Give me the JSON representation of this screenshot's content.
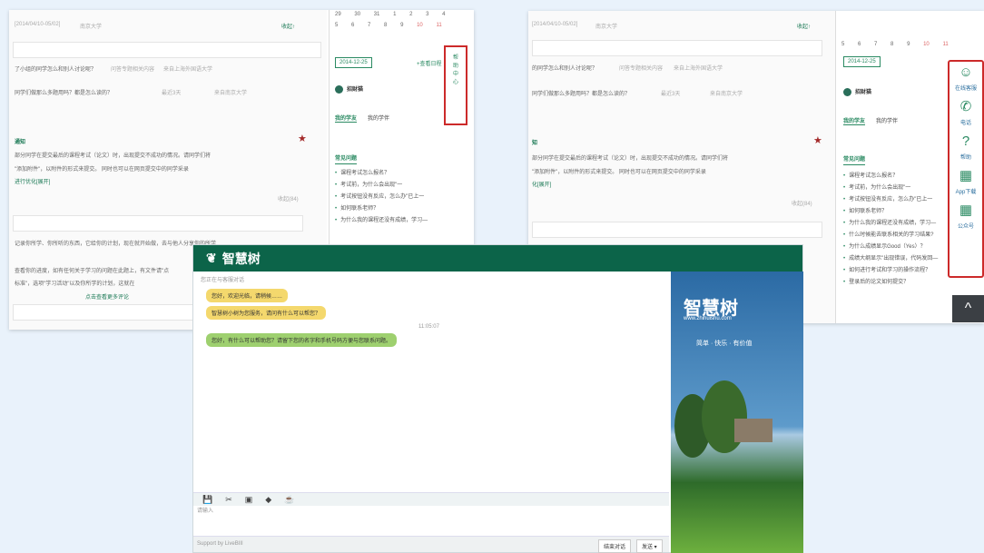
{
  "left": {
    "header_date": "[2014/04/10-05/02]",
    "header_org": "南京大学",
    "header_link": "收起↑",
    "rows": [
      "了小组的同学怎么和别人讨论呢？",
      "问答专题相关内容",
      "来自上海外国语大学"
    ],
    "rows2": [
      "同学们做那么多题用吗？都是怎么读的？",
      "最近3天",
      "来自南京大学"
    ],
    "notice_title": "通知",
    "notice_body": [
      "部分同学在提交最后的课程考试（论文）时，出现提交不成功的情况。请同学们将",
      "\"添加附件\"，以附件的形式来提交。   同时也可以在网页提交中的同学采录",
      "进行优化[展开]"
    ],
    "notice_link": "收起(84)",
    "rows3": "记录你所学、你所听的东西，它给你的计划，现在就开始做，去与他人分享你的所学",
    "rows4": [
      "查看你的进度，如有任何关于学习的问题在此题上，有文件请\"点",
      "标准\"，选项\"学习活动\"以及你所学的计划，这就在",
      "去"
    ],
    "more_link": "点击查看更多评论"
  },
  "calendar": {
    "row1": [
      "29",
      "30",
      "31",
      "1",
      "2",
      "3",
      "4"
    ],
    "row2": [
      "5",
      "6",
      "7",
      "8",
      "9",
      "10",
      "11"
    ]
  },
  "side": {
    "date": "2014-12-25",
    "date_link": "+查看日程",
    "user": "招财猫",
    "tabs": [
      "我的学友",
      "我的学伴"
    ],
    "faq_title": "常见问题",
    "faq": [
      "课程考试怎么报名？",
      "考试前，为什么会出现\"一",
      "考试按钮没有反应，怎么办\"已上一",
      "如何联系老师？",
      "为什么我的课程还没有成绩，学习—",
      "什么时候能去联系相关的学习结果?",
      "为什么成绩显示Good（Yes）？",
      "成绩大纲显示\"出现错误，代码发回—",
      "如何进行考试和学习的操作流程？",
      "登录后的论文如何提交？"
    ],
    "toggle_text": "帮助中心"
  },
  "right_header": {
    "date": "[2014/04/10-05/02]",
    "org": "南京大学",
    "link": "收起↑"
  },
  "right_rows": [
    "的同学怎么和别人讨论呢？",
    "问答专题相关内容",
    "来自上海外国语大学"
  ],
  "right_rows2": [
    "同学们做那么多题用吗？都是怎么读的？",
    "最近3天",
    "来自南京大学"
  ],
  "right_notice": {
    "title": "知",
    "body": [
      "部分同学在提交最后的课程考试（论文）时，出现提交不成功的情况。请同学们将",
      "\"添加附件\"，以附件的形式来提交。     同时也可以在网页提交中的同学采录",
      "化[展开]"
    ],
    "link": "收起(84)"
  },
  "right_calendar": {
    "row2": [
      "5",
      "6",
      "7",
      "8",
      "9",
      "10",
      "11"
    ]
  },
  "right_sidebar": [
    {
      "label": "在线客服",
      "icon": "☺"
    },
    {
      "label": "电话",
      "icon": "✆"
    },
    {
      "label": "帮助",
      "icon": "?"
    },
    {
      "label": "App下载",
      "icon": "▦"
    },
    {
      "label": "公众号",
      "icon": "▦"
    }
  ],
  "back_top": "^",
  "chat": {
    "brand": "智慧树",
    "brand_sub": "www.zhihuishu.com",
    "status": "您正在与客服对话",
    "bubbles": [
      "您好，欢迎光临，请稍候……",
      "智慧树小树为您服务，请问有什么可以帮您？",
      "您好，有什么可以帮助您？请留下您的名字和手机号码方便与您联系问题。"
    ],
    "time": "11:05:07",
    "tools": [
      "💾",
      "✂",
      "▣",
      "◆",
      "☕"
    ],
    "input_placeholder": "请输入",
    "powered": "Support by LiveBIII",
    "btn_end": "结束对话",
    "btn_send": "发送 ▾",
    "slogan": "简单 · 快乐 · 有价值"
  },
  "colors": {
    "brand": "#0c6449",
    "accent": "#2a8a62",
    "highlight": "#cc2a2a"
  }
}
